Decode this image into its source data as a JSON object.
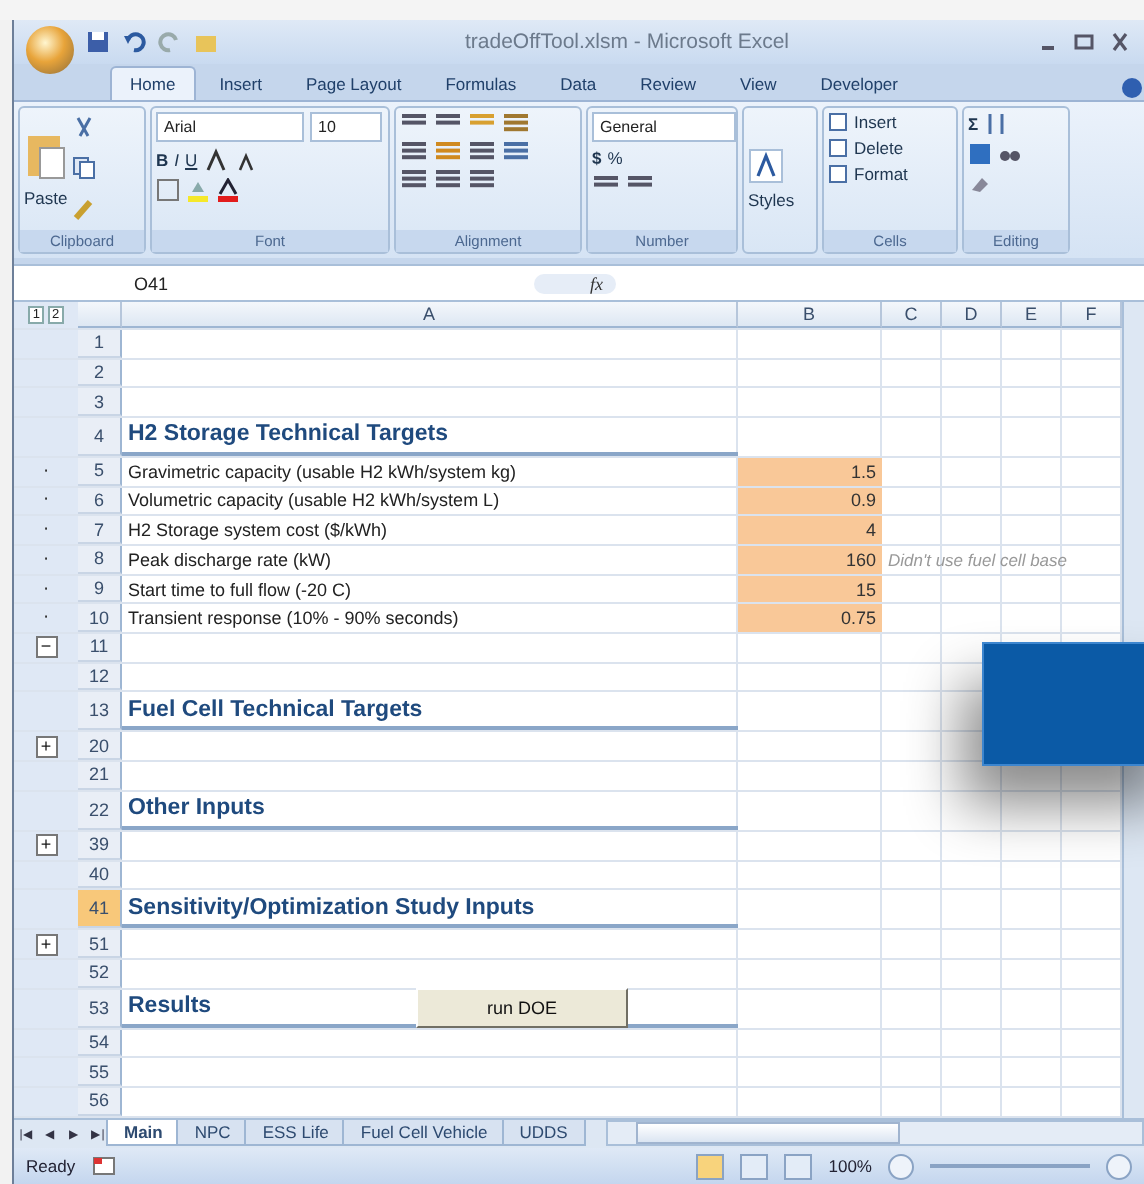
{
  "window": {
    "title": "tradeOffTool.xlsm - Microsoft Excel"
  },
  "ribbon_tabs": [
    {
      "label": "Home",
      "selected": true
    },
    {
      "label": "Insert",
      "selected": false
    },
    {
      "label": "Page Layout",
      "selected": false
    },
    {
      "label": "Formulas",
      "selected": false
    },
    {
      "label": "Data",
      "selected": false
    },
    {
      "label": "Review",
      "selected": false
    },
    {
      "label": "View",
      "selected": false
    },
    {
      "label": "Developer",
      "selected": false
    }
  ],
  "ribbon": {
    "paste": "Paste",
    "font_name": "Arial",
    "font_size": "10",
    "bold": "B",
    "italic": "I",
    "underline": "U",
    "number_format": "General",
    "currency": "$",
    "percent": "%",
    "styles": "Styles",
    "cells": [
      "Insert",
      "Delete",
      "Format"
    ],
    "sigma": "Σ",
    "groups": [
      "Clipboard",
      "Font",
      "Alignment",
      "Number",
      "Cells",
      "Editing"
    ]
  },
  "formula_bar": {
    "name_box": "O41",
    "fx": "fx"
  },
  "outline_levels": [
    "1",
    "2"
  ],
  "columns": [
    "A",
    "B",
    "C",
    "D",
    "E",
    "F"
  ],
  "rows": [
    {
      "number": "1",
      "kind": "blank",
      "selected": false
    },
    {
      "number": "2",
      "kind": "blank",
      "selected": false
    },
    {
      "number": "3",
      "kind": "blank",
      "selected": false
    },
    {
      "number": "4",
      "kind": "heading",
      "a": "H2 Storage Technical Targets",
      "selected": false
    },
    {
      "number": "5",
      "kind": "data",
      "outline": "·",
      "a": "Gravimetric capacity (usable H2 kWh/system kg)",
      "b": "1.5",
      "selected": false
    },
    {
      "number": "6",
      "kind": "data",
      "outline": "·",
      "a": "Volumetric capacity (usable H2 kWh/system L)",
      "b": "0.9",
      "selected": false
    },
    {
      "number": "7",
      "kind": "data",
      "outline": "·",
      "a": "H2 Storage system cost ($/kWh)",
      "b": "4",
      "selected": false
    },
    {
      "number": "8",
      "kind": "data",
      "outline": "·",
      "a": "Peak discharge rate (kW)",
      "b": "160",
      "c": "Didn't use fuel cell base",
      "selected": false
    },
    {
      "number": "9",
      "kind": "data",
      "outline": "·",
      "a": "Start time to full flow (-20 C)",
      "b": "15",
      "selected": false
    },
    {
      "number": "10",
      "kind": "data",
      "outline": "·",
      "a": "Transient response (10% - 90% seconds)",
      "b": "0.75",
      "selected": false
    },
    {
      "number": "11",
      "kind": "blank",
      "outline": "−",
      "selected": false
    },
    {
      "number": "12",
      "kind": "blank",
      "selected": false
    },
    {
      "number": "13",
      "kind": "heading",
      "a": "Fuel Cell Technical Targets",
      "selected": false
    },
    {
      "number": "20",
      "kind": "blank",
      "outline": "+",
      "selected": false
    },
    {
      "number": "21",
      "kind": "blank",
      "selected": false
    },
    {
      "number": "22",
      "kind": "heading",
      "a": "Other Inputs",
      "selected": false
    },
    {
      "number": "39",
      "kind": "blank",
      "outline": "+",
      "selected": false
    },
    {
      "number": "40",
      "kind": "blank",
      "selected": false
    },
    {
      "number": "41",
      "kind": "heading",
      "a": "Sensitivity/Optimization Study Inputs",
      "selected": true
    },
    {
      "number": "51",
      "kind": "blank",
      "outline": "+",
      "selected": false
    },
    {
      "number": "52",
      "kind": "blank",
      "selected": false
    },
    {
      "number": "53",
      "kind": "heading",
      "a": "Results",
      "selected": false
    },
    {
      "number": "54",
      "kind": "blank",
      "selected": false
    },
    {
      "number": "55",
      "kind": "blank",
      "selected": false
    },
    {
      "number": "56",
      "kind": "blank",
      "selected": false
    }
  ],
  "sheet_button": "run DOE",
  "sheet_nav": [
    "|◀",
    "◀",
    "▶",
    "▶|"
  ],
  "sheet_tabs": [
    {
      "label": "Main",
      "selected": true
    },
    {
      "label": "NPC",
      "selected": false
    },
    {
      "label": "ESS Life",
      "selected": false
    },
    {
      "label": "Fuel Cell Vehicle",
      "selected": false
    },
    {
      "label": "UDDS",
      "selected": false
    }
  ],
  "status_bar": {
    "status": "Ready",
    "zoom": "100%",
    "views": [
      {
        "selected": true
      },
      {
        "selected": false
      },
      {
        "selected": false
      }
    ]
  }
}
